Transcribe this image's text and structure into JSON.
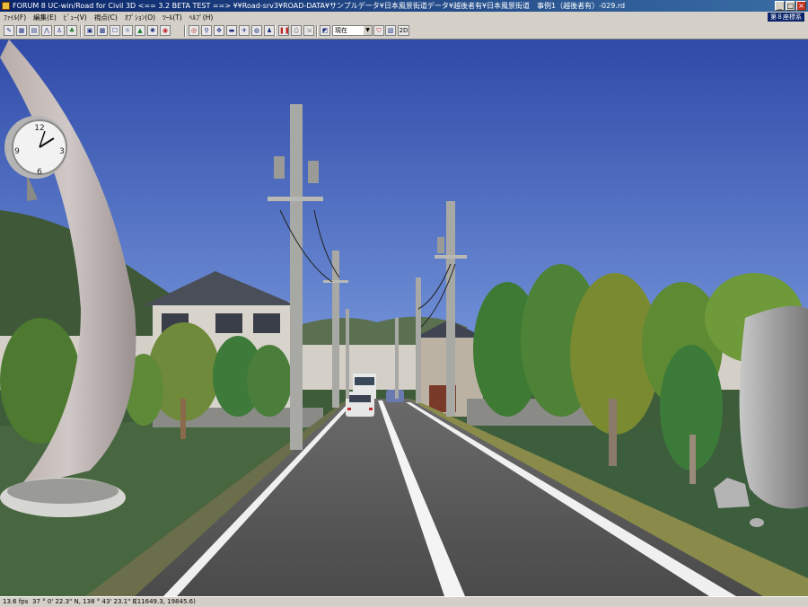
{
  "window": {
    "title": "FORUM 8    UC-win/Road for Civil 3D    <== 3.2 BETA TEST ==>    ¥¥Road-srv3¥ROAD-DATA¥サンプルデータ¥日本風景街道データ¥越後者有¥日本風景街道　事例1（越後者有）-029.rd",
    "coordinate_system": "第８座標系"
  },
  "menu": [
    "ﾌｧｲﾙ(F)",
    "編集(E)",
    "ﾋﾞｭｰ(V)",
    "視点(C)",
    "ｵﾌﾟｼｮﾝ(O)",
    "ﾂｰﾙ(T)",
    "ﾍﾙﾌﾟ(H)"
  ],
  "toolbar": {
    "view_select": "現在",
    "view_2d": "2D"
  },
  "status": {
    "fps": "13.6 fps",
    "geo": "37 ° 0' 22.3\" N, 138 ° 43' 23.1\" E",
    "position": "(11649.3, 19845.6)"
  },
  "scene": {
    "clock_numbers": [
      "12",
      "3",
      "6",
      "9"
    ],
    "sky": "#3f5fb4",
    "ground": "#3e5c3a",
    "road": "#505050"
  }
}
